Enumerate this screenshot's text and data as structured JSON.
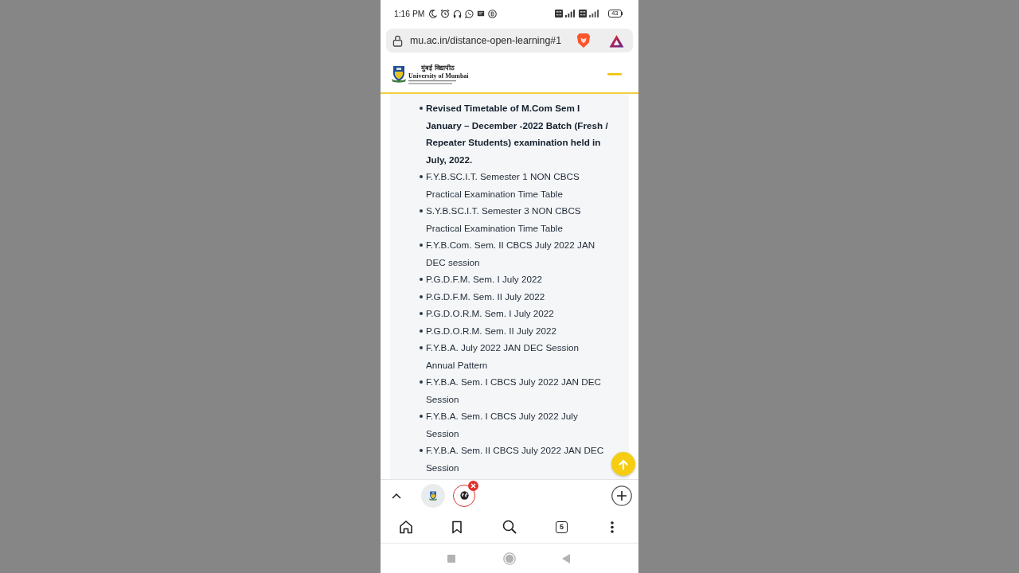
{
  "status_bar": {
    "time": "1:16 PM",
    "battery": "43"
  },
  "address_bar": {
    "url": "mu.ac.in/distance-open-learning#1"
  },
  "site_header": {
    "logo": {
      "title_native": "मुंबई विद्यापीठ",
      "title": "University of Mumbai"
    }
  },
  "content": {
    "items": [
      {
        "text": "Revised Timetable of M.Com Sem I January – December -2022 Batch (Fresh / Repeater Students) examination held in July, 2022.",
        "bold": true
      },
      {
        "text": "F.Y.B.SC.I.T. Semester 1 NON CBCS Practical Examination Time Table",
        "bold": false
      },
      {
        "text": "S.Y.B.SC.I.T. Semester 3 NON CBCS Practical Examination Time Table",
        "bold": false
      },
      {
        "text": "F.Y.B.Com. Sem. II CBCS July 2022 JAN DEC session",
        "bold": false
      },
      {
        "text": "P.G.D.F.M. Sem. I July 2022",
        "bold": false
      },
      {
        "text": "P.G.D.F.M. Sem. II July 2022",
        "bold": false
      },
      {
        "text": "P.G.D.O.R.M. Sem. I July 2022",
        "bold": false
      },
      {
        "text": "P.G.D.O.R.M. Sem. II July 2022",
        "bold": false
      },
      {
        "text": "F.Y.B.A. July 2022 JAN DEC Session Annual Pattern",
        "bold": false
      },
      {
        "text": "F.Y.B.A. Sem. I CBCS July 2022 JAN DEC Session",
        "bold": false
      },
      {
        "text": "F.Y.B.A. Sem. I CBCS July 2022 July Session",
        "bold": false
      },
      {
        "text": "F.Y.B.A. Sem. II CBCS July 2022 JAN DEC Session",
        "bold": false
      }
    ]
  },
  "tab_strip": {
    "tabs": [
      {
        "kind": "favicon",
        "selected": false
      },
      {
        "kind": "globe",
        "selected": true
      }
    ]
  },
  "toolbar": {
    "tab_count": "5"
  }
}
